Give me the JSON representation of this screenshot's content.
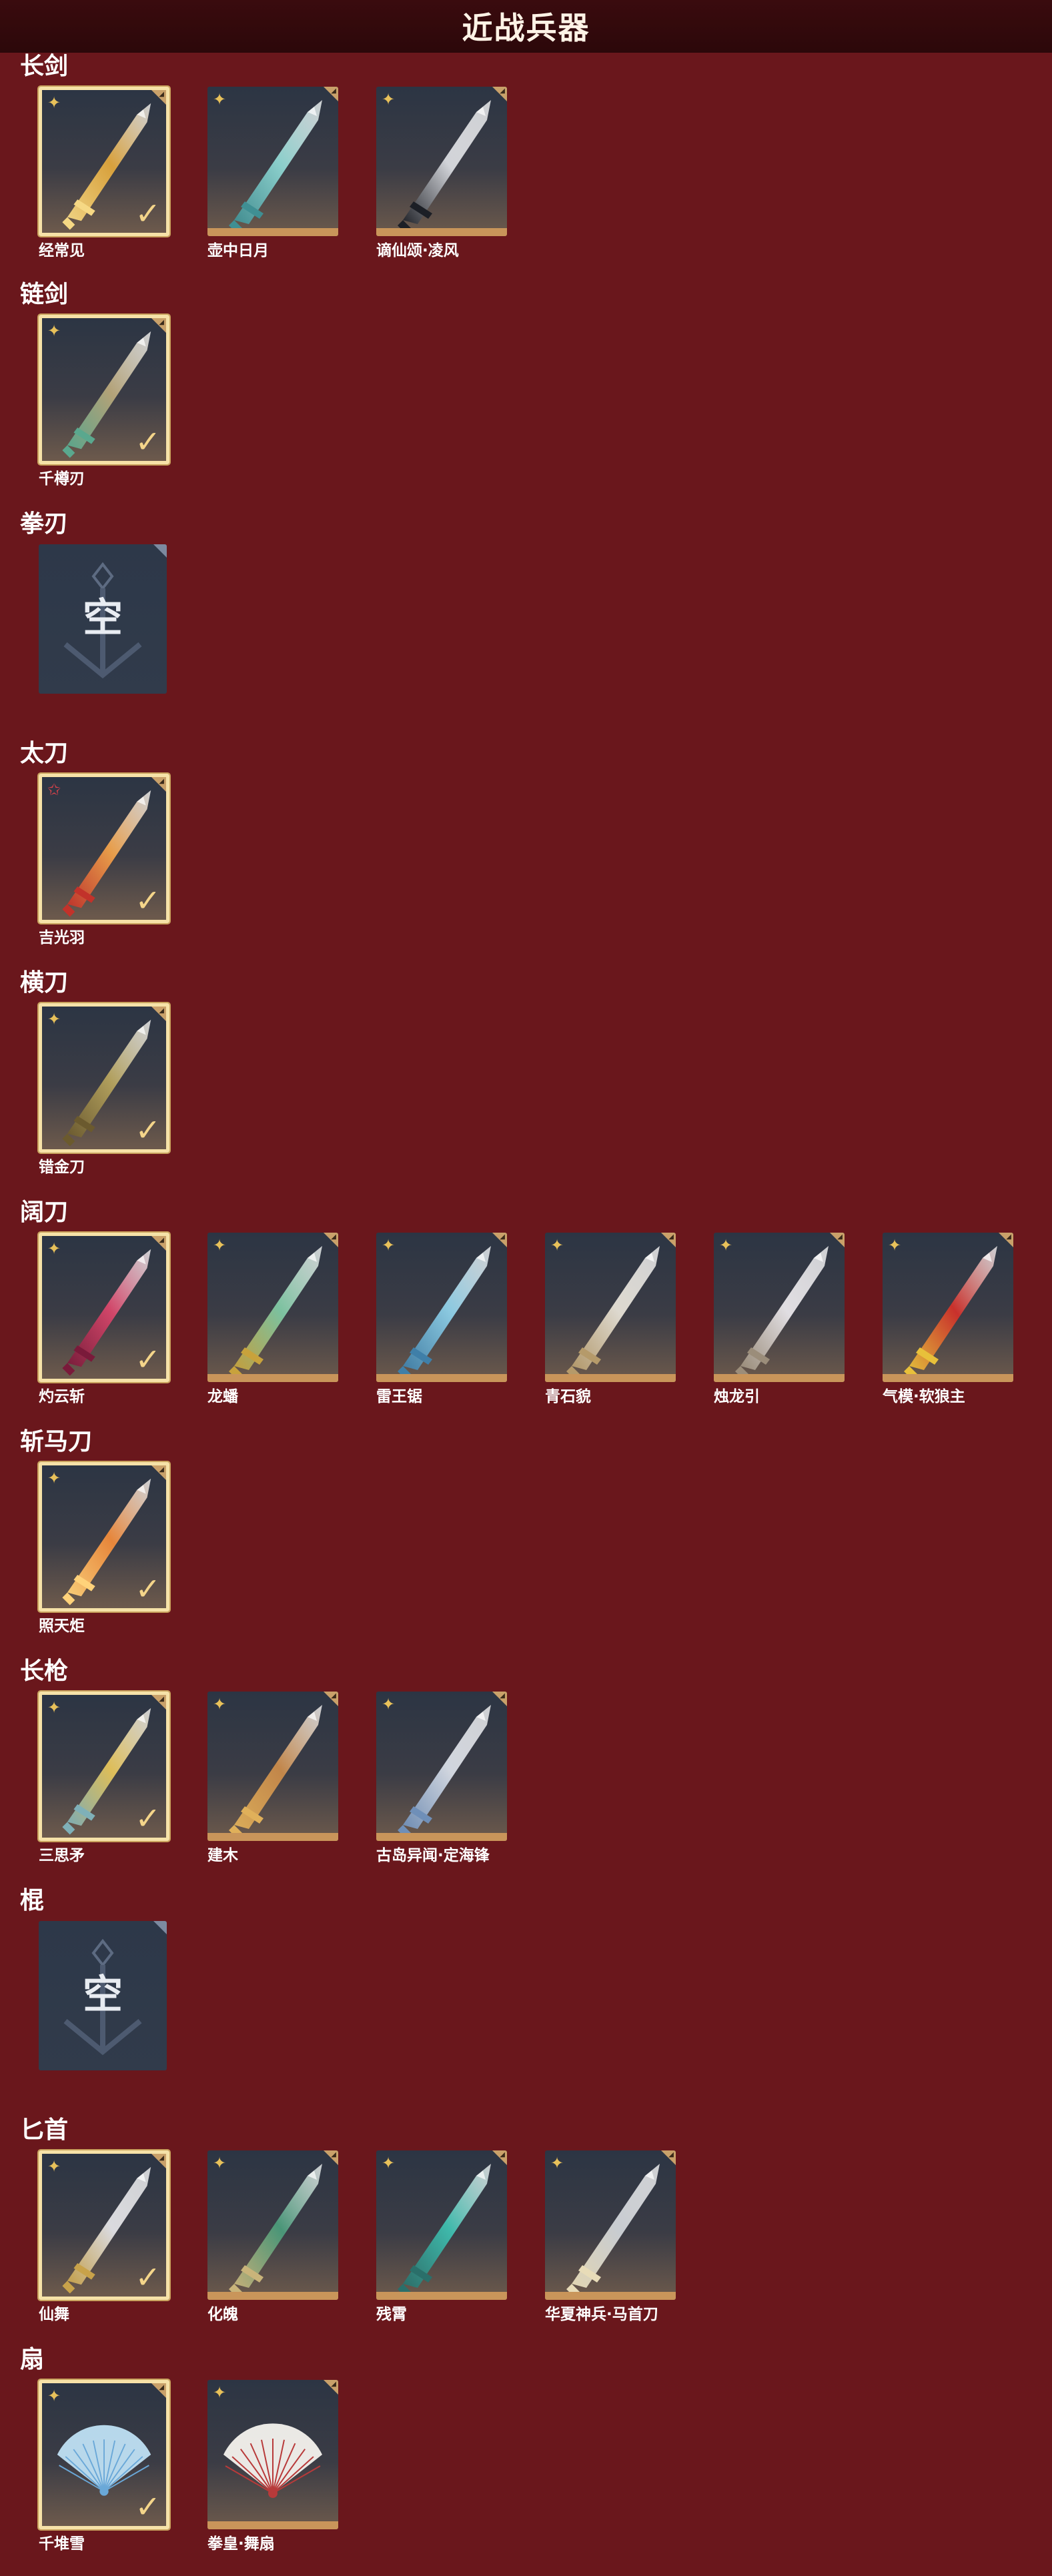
{
  "header": {
    "title": "近战兵器"
  },
  "categories": [
    {
      "title": "长剑",
      "items": [
        {
          "label": "经常见",
          "rarity": "gold",
          "equipped": true,
          "icon": "sword-gold-icon",
          "blade": "#e0a63c",
          "accent": "#f6d884"
        },
        {
          "label": "壶中日月",
          "rarity": "gold",
          "equipped": false,
          "icon": "sword-jade-icon",
          "blade": "#8fd6d2",
          "accent": "#3f8f93"
        },
        {
          "label": "谪仙颂·凌风",
          "rarity": "gold",
          "equipped": false,
          "icon": "sword-dark-icon",
          "blade": "#d9dbe0",
          "accent": "#1c1f26"
        }
      ]
    },
    {
      "title": "链剑",
      "items": [
        {
          "label": "千樽刃",
          "rarity": "gold",
          "equipped": true,
          "icon": "chain-sword-icon",
          "blade": "#b9a77a",
          "accent": "#5aa88e"
        }
      ]
    },
    {
      "title": "拳刃",
      "empty": true,
      "empty_text": "空"
    },
    {
      "title": "太刀",
      "items": [
        {
          "label": "吉光羽",
          "rarity": "red",
          "equipped": true,
          "icon": "katana-flame-icon",
          "blade": "#f0a24a",
          "accent": "#c2322a"
        }
      ]
    },
    {
      "title": "横刀",
      "items": [
        {
          "label": "错金刀",
          "rarity": "gold",
          "equipped": true,
          "icon": "hengdao-gold-icon",
          "blade": "#b7a45e",
          "accent": "#6b5a2e"
        }
      ]
    },
    {
      "title": "阔刀",
      "items": [
        {
          "label": "灼云斩",
          "rarity": "gold",
          "equipped": true,
          "icon": "broadblade-crimson-icon",
          "blade": "#d9476b",
          "accent": "#7a1a3a"
        },
        {
          "label": "龙蟠",
          "rarity": "gold",
          "equipped": false,
          "icon": "broadblade-jade-icon",
          "blade": "#7fc8a4",
          "accent": "#c8a23c"
        },
        {
          "label": "雷王锯",
          "rarity": "gold",
          "equipped": false,
          "icon": "broadblade-ice-icon",
          "blade": "#8fd0e8",
          "accent": "#3f7fa8"
        },
        {
          "label": "青石貌",
          "rarity": "gold",
          "equipped": false,
          "icon": "broadblade-white-icon",
          "blade": "#e6e1d6",
          "accent": "#b59a6a"
        },
        {
          "label": "烛龙引",
          "rarity": "gold",
          "equipped": false,
          "icon": "broadblade-silver-icon",
          "blade": "#e9e6ea",
          "accent": "#9b8d7a"
        },
        {
          "label": "气模·软狼主",
          "rarity": "gold",
          "equipped": false,
          "icon": "broadblade-red-gold-icon",
          "blade": "#d0302a",
          "accent": "#e8c03a"
        }
      ]
    },
    {
      "title": "斩马刀",
      "items": [
        {
          "label": "照天炬",
          "rarity": "gold",
          "equipped": true,
          "icon": "zhanmadao-fire-icon",
          "blade": "#f08a3a",
          "accent": "#ffd27a"
        }
      ]
    },
    {
      "title": "长枪",
      "items": [
        {
          "label": "三思矛",
          "rarity": "gold",
          "equipped": true,
          "icon": "spear-gold-icon",
          "blade": "#e6c45a",
          "accent": "#7fb0b8"
        },
        {
          "label": "建木",
          "rarity": "gold",
          "equipped": false,
          "icon": "spear-wood-icon",
          "blade": "#c98a4a",
          "accent": "#e0b05a"
        },
        {
          "label": "古岛异闻·定海锋",
          "rarity": "gold",
          "equipped": false,
          "icon": "spear-silver-icon",
          "blade": "#d8dde6",
          "accent": "#6f8fb8"
        }
      ]
    },
    {
      "title": "棍",
      "empty": true,
      "empty_text": "空"
    },
    {
      "title": "匕首",
      "items": [
        {
          "label": "仙舞",
          "rarity": "gold",
          "equipped": true,
          "icon": "dagger-silver-icon",
          "blade": "#e2e2e6",
          "accent": "#c8a24a"
        },
        {
          "label": "化魄",
          "rarity": "gold",
          "equipped": false,
          "icon": "dagger-curved-icon",
          "blade": "#4a9a7a",
          "accent": "#c9b47a"
        },
        {
          "label": "残霄",
          "rarity": "gold",
          "equipped": false,
          "icon": "dagger-teal-icon",
          "blade": "#3fbfb0",
          "accent": "#2a6f6a"
        },
        {
          "label": "华夏神兵·马首刀",
          "rarity": "gold",
          "equipped": false,
          "icon": "dagger-horsehead-icon",
          "blade": "#cfd3d8",
          "accent": "#e8dcb8"
        }
      ]
    },
    {
      "title": "扇",
      "items": [
        {
          "label": "千堆雪",
          "rarity": "gold",
          "equipped": true,
          "icon": "fan-crystal-icon",
          "blade": "#bfe0f4",
          "accent": "#6aa8d8"
        },
        {
          "label": "拳皇·舞扇",
          "rarity": "gold",
          "equipped": false,
          "icon": "fan-white-icon",
          "blade": "#f4f2ee",
          "accent": "#b83a3a"
        }
      ]
    }
  ]
}
